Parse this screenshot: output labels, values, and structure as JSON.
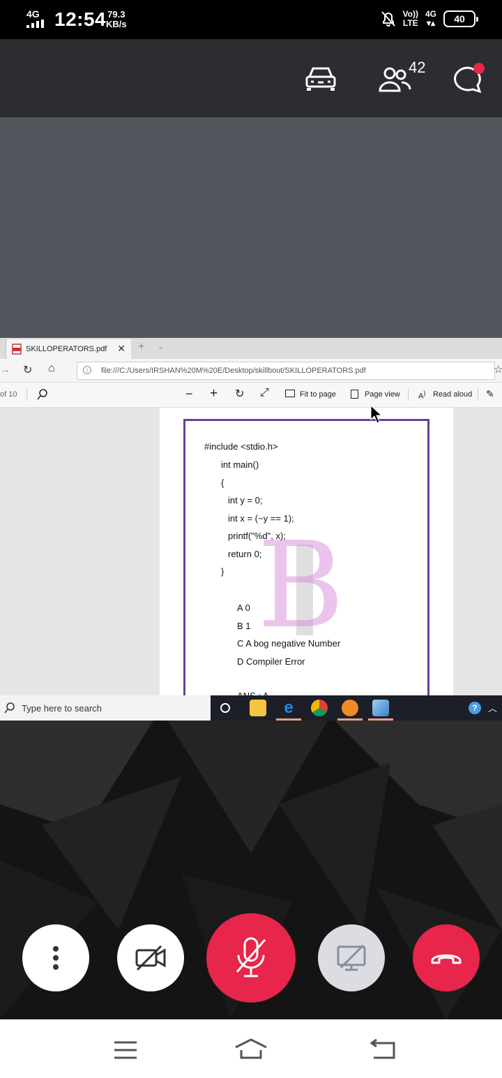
{
  "status_bar": {
    "network": "4G",
    "time": "12:54",
    "speed_value": "79.3",
    "speed_unit": "KB/s",
    "volte_line1": "Vo))",
    "volte_line2": "LTE",
    "network_right": "4G",
    "battery": "40"
  },
  "call_header": {
    "participants_count": "42",
    "icons": [
      "car-mode-icon",
      "participants-icon",
      "chat-icon"
    ]
  },
  "browser": {
    "tab_title": "SKILLOPERATORS.pdf",
    "tab_close": "✕",
    "new_tab": "+",
    "address": "file:///C:/Users/IRSHAN%20M%20E/Desktop/skillbout/SKILLOPERATORS.pdf",
    "page_of": "of 10",
    "fit_to_page": "Fit to page",
    "page_view": "Page view",
    "read_aloud": "Read aloud"
  },
  "document": {
    "lines": [
      "#include <stdio.h>",
      "int main()",
      "{",
      "int y = 0;",
      "int x = (~y == 1);",
      "printf(\"%d\", x);",
      "return 0;",
      "}",
      "A 0",
      "B 1",
      "C A bog negative Number",
      "D Compiler Error",
      "ANS : A"
    ],
    "watermark_letter": "B"
  },
  "taskbar": {
    "search_placeholder": "Type here to search"
  },
  "controls": {
    "accent": "#e8254a",
    "items": [
      "more-options",
      "camera-off",
      "microphone-muted",
      "screen-share-off",
      "end-call"
    ]
  }
}
